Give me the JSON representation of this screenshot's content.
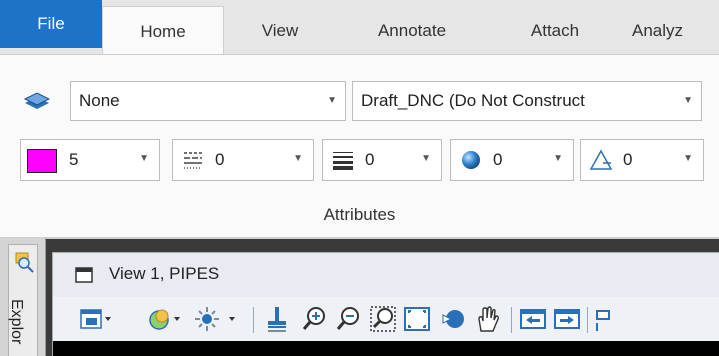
{
  "ribbon": {
    "tabs": {
      "file": "File",
      "home": "Home",
      "view": "View",
      "annotate": "Annotate",
      "attach": "Attach",
      "analyze": "Analyz"
    },
    "active_tab": "Home",
    "level": {
      "value": "None"
    },
    "model": {
      "value": "Draft_DNC (Do Not Construct"
    },
    "attributes": {
      "color": {
        "value": "5",
        "swatch": "#ff00ff"
      },
      "line_style": {
        "value": "0"
      },
      "line_weight": {
        "value": "0"
      },
      "transparency": {
        "value": "0"
      },
      "priority": {
        "value": "0"
      }
    },
    "group_label": "Attributes"
  },
  "explorer": {
    "label": "Explor"
  },
  "view_window": {
    "title": "View 1, PIPES",
    "toolbar_icons": [
      "view-attributes-icon",
      "display-style-icon",
      "lighting-icon",
      "fit-icon",
      "zoom-in-icon",
      "zoom-out-icon",
      "window-area-icon",
      "fit-view-icon",
      "rotate-view-icon",
      "pan-view-icon",
      "previous-view-icon",
      "next-view-icon",
      "copy-view-icon"
    ]
  },
  "colors": {
    "file_tab": "#1e73c8",
    "accent_blue": "#2b6fb6",
    "canvas": "#000000"
  }
}
